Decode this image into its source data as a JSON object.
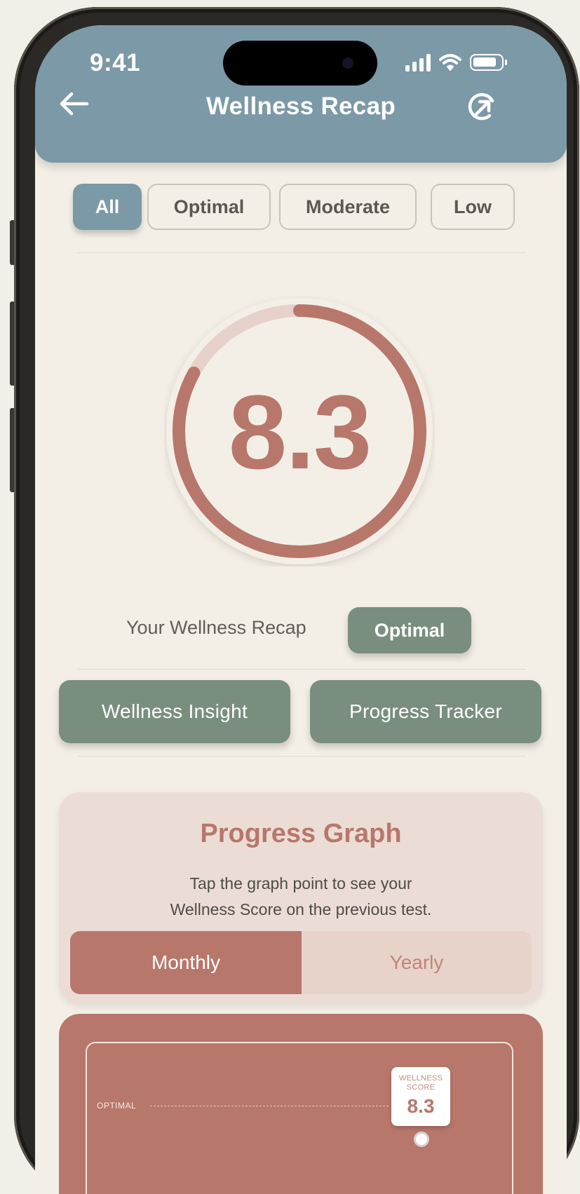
{
  "status_bar": {
    "time": "9:41"
  },
  "header": {
    "title": "Wellness Recap",
    "back_icon": "arrow-left-icon",
    "action_icon": "share-arrow-icon"
  },
  "filters": [
    {
      "label": "All",
      "active": true
    },
    {
      "label": "Optimal",
      "active": false
    },
    {
      "label": "Moderate",
      "active": false
    },
    {
      "label": "Low",
      "active": false
    }
  ],
  "gauge": {
    "score": "8.3",
    "progress_fraction": 0.83,
    "color": "#b8776b",
    "track_color": "#e6d2ca"
  },
  "recap": {
    "label": "Your Wellness Recap",
    "badge": "Optimal"
  },
  "actions": {
    "insight": "Wellness Insight",
    "tracker": "Progress Tracker"
  },
  "progress_graph": {
    "title": "Progress Graph",
    "description_line1": "Tap the graph point to see your",
    "description_line2": "Wellness Score on the previous test.",
    "toggle": {
      "monthly": "Monthly",
      "yearly": "Yearly",
      "selected": "Monthly"
    }
  },
  "chart": {
    "reference_label": "OPTIMAL",
    "tag_label_line1": "WELLNESS",
    "tag_label_line2": "SCORE",
    "tag_value": "8.3"
  },
  "colors": {
    "header": "#7b99a6",
    "accent": "#b8776b",
    "sage": "#7a8e80",
    "background": "#f3efe6"
  }
}
